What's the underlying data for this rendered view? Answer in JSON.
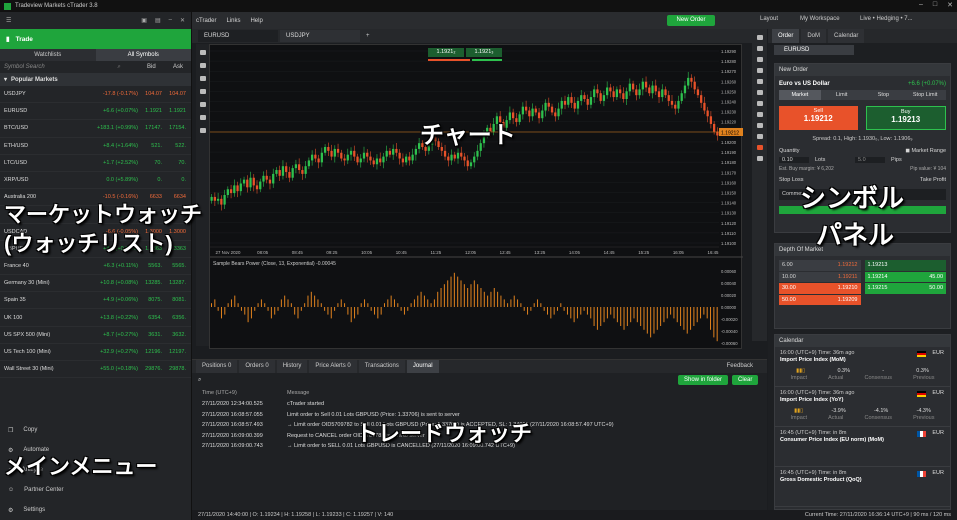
{
  "window": {
    "title": "Tradeview Markets cTrader 3.8"
  },
  "left": {
    "trade_label": "Trade",
    "tabs": [
      "Watchlists",
      "All Symbols"
    ],
    "search_placeholder": "Symbol Search",
    "col_bid": "Bid",
    "col_ask": "Ask",
    "section": "Popular Markets",
    "symbols": [
      {
        "name": "USDJPY",
        "chg": "-17.8 (-0.17%)",
        "bid": "104.07",
        "ask": "104.07",
        "dir": "neg"
      },
      {
        "name": "EURUSD",
        "chg": "+6.6 (+0.07%)",
        "bid": "1.1921",
        "ask": "1.1921",
        "dir": "pos"
      },
      {
        "name": "BTC/USD",
        "chg": "+183.1 (+0.99%)",
        "bid": "17147.",
        "ask": "17154.",
        "dir": "pos"
      },
      {
        "name": "ETH/USD",
        "chg": "+8.4 (+1.64%)",
        "bid": "521.",
        "ask": "522.",
        "dir": "pos"
      },
      {
        "name": "LTC/USD",
        "chg": "+1.7 (+2.52%)",
        "bid": "70.",
        "ask": "70.",
        "dir": "pos"
      },
      {
        "name": "XRP/USD",
        "chg": "0.0 (+5.89%)",
        "bid": "0.",
        "ask": "0.",
        "dir": "pos"
      },
      {
        "name": "Australia 200",
        "chg": "-10.5 (-0.16%)",
        "bid": "6633",
        "ask": "6634",
        "dir": "neg"
      },
      {
        "name": "",
        "chg": "",
        "bid": "",
        "ask": "",
        "dir": "pos"
      },
      {
        "name": "USDCAD",
        "chg": "-6.6 (-0.05%)",
        "bid": "1.3000",
        "ask": "1.3000",
        "dir": "neg"
      },
      {
        "name": "GBPUSD",
        "chg": "+8.3 (+0.06%)",
        "bid": "1.3363",
        "ask": "1.3363",
        "dir": "pos"
      },
      {
        "name": "France 40",
        "chg": "+6.3 (+0.11%)",
        "bid": "5563.",
        "ask": "5565.",
        "dir": "pos"
      },
      {
        "name": "Germany 30 (Mini)",
        "chg": "+10.8 (+0.08%)",
        "bid": "13285.",
        "ask": "13287.",
        "dir": "pos"
      },
      {
        "name": "Spain 35",
        "chg": "+4.9 (+0.06%)",
        "bid": "8075.",
        "ask": "8081.",
        "dir": "pos"
      },
      {
        "name": "UK 100",
        "chg": "+13.8 (+0.22%)",
        "bid": "6354.",
        "ask": "6356.",
        "dir": "pos"
      },
      {
        "name": "US SPX 500 (Mini)",
        "chg": "+8.7 (+0.27%)",
        "bid": "3631.",
        "ask": "3632.",
        "dir": "pos"
      },
      {
        "name": "US Tech 100 (Mini)",
        "chg": "+32.9 (+0.27%)",
        "bid": "12196.",
        "ask": "12197.",
        "dir": "pos"
      },
      {
        "name": "Wall Street 30 (Mini)",
        "chg": "+55.0 (+0.18%)",
        "bid": "29876.",
        "ask": "29878.",
        "dir": "pos"
      }
    ],
    "menu": [
      "Copy",
      "Automate",
      "Analyze",
      "Partner Center",
      "Settings"
    ]
  },
  "overlays": {
    "market_watch": "マーケットウォッチ",
    "watchlist": "(ウォッチリスト)",
    "main_menu": "メインメニュー",
    "chart": "チャート",
    "symbol": "シンボル",
    "panel": "パネル",
    "trade_watch": "トレードウォッチ"
  },
  "topbar": {
    "menus": [
      "cTrader",
      "Links",
      "Help"
    ],
    "new_order": "New Order",
    "layout": "Layout",
    "workspace": "My Workspace",
    "account": "Live • Hedging • 7..."
  },
  "chart_tabs": [
    "EURUSD",
    "USDJPY"
  ],
  "chart": {
    "sell_price": "1.1921₂",
    "buy_price": "1.1921₃",
    "price_ticks": [
      "1.19290",
      "1.19280",
      "1.19270",
      "1.19260",
      "1.19250",
      "1.19240",
      "1.19230",
      "1.19220",
      "1.19210",
      "1.19200",
      "1.19190",
      "1.19180",
      "1.19170",
      "1.19160",
      "1.19150",
      "1.19140",
      "1.19130",
      "1.19120",
      "1.19110",
      "1.19100"
    ],
    "current_price": "1.19212",
    "time_ticks": [
      "27 Nov 2020",
      "08:05",
      "08:45",
      "09:25",
      "10:05",
      "10:45",
      "11:25",
      "12:05",
      "12:45",
      "13:25",
      "14:05",
      "14:45",
      "15:25",
      "16:05",
      "16:45"
    ],
    "indicator_label": "Sample Bears Power (Close, 13, Exponential) -0.00045",
    "indicator_ticks": [
      "0.00060",
      "0.00040",
      "0.00020",
      "0.00000",
      "-0.00020",
      "-0.00040",
      "-0.00060"
    ],
    "closes": [
      0.24,
      0.22,
      0.23,
      0.2,
      0.25,
      0.28,
      0.26,
      0.3,
      0.27,
      0.31,
      0.33,
      0.29,
      0.34,
      0.3,
      0.28,
      0.32,
      0.35,
      0.33,
      0.31,
      0.36,
      0.38,
      0.35,
      0.4,
      0.37,
      0.34,
      0.39,
      0.41,
      0.38,
      0.36,
      0.4,
      0.43,
      0.46,
      0.44,
      0.42,
      0.47,
      0.5,
      0.48,
      0.45,
      0.49,
      0.47,
      0.44,
      0.43,
      0.46,
      0.48,
      0.45,
      0.42,
      0.44,
      0.47,
      0.45,
      0.43,
      0.41,
      0.44,
      0.42,
      0.45,
      0.48,
      0.46,
      0.49,
      0.47,
      0.44,
      0.42,
      0.45,
      0.43,
      0.46,
      0.49,
      0.52,
      0.5,
      0.48,
      0.51,
      0.55,
      0.53,
      0.5,
      0.48,
      0.45,
      0.43,
      0.46,
      0.44,
      0.47,
      0.45,
      0.43,
      0.4,
      0.42,
      0.45,
      0.48,
      0.52,
      0.56,
      0.6,
      0.58,
      0.62,
      0.66,
      0.63,
      0.6,
      0.64,
      0.68,
      0.65,
      0.63,
      0.67,
      0.71,
      0.69,
      0.66,
      0.7,
      0.68,
      0.65,
      0.69,
      0.73,
      0.71,
      0.68,
      0.66,
      0.7,
      0.74,
      0.72,
      0.76,
      0.73,
      0.7,
      0.74,
      0.77,
      0.75,
      0.72,
      0.76,
      0.8,
      0.78,
      0.74,
      0.77,
      0.81,
      0.79,
      0.76,
      0.8,
      0.78,
      0.75,
      0.79,
      0.83,
      0.8,
      0.77,
      0.8,
      0.84,
      0.81,
      0.78,
      0.82,
      0.79,
      0.76,
      0.8,
      0.77,
      0.74,
      0.72,
      0.7,
      0.74,
      0.78,
      0.82,
      0.86,
      0.84,
      0.8,
      0.77,
      0.73,
      0.69,
      0.66,
      0.62,
      0.58,
      0.56
    ],
    "bears": [
      0.1,
      0.2,
      -0.1,
      -0.3,
      -0.2,
      0.1,
      0.2,
      0.3,
      0.1,
      -0.1,
      -0.2,
      -0.4,
      -0.3,
      -0.1,
      0.1,
      0.2,
      0.1,
      -0.1,
      -0.3,
      -0.2,
      -0.1,
      0.2,
      0.3,
      0.2,
      0.1,
      -0.2,
      -0.3,
      -0.1,
      0.1,
      0.3,
      0.4,
      0.3,
      0.2,
      0.1,
      -0.1,
      -0.2,
      -0.3,
      -0.1,
      0.1,
      0.2,
      0.1,
      -0.2,
      -0.4,
      -0.3,
      -0.2,
      0.1,
      0.2,
      0.1,
      -0.1,
      -0.2,
      -0.3,
      -0.2,
      0.1,
      0.2,
      0.3,
      0.2,
      0.1,
      -0.1,
      -0.2,
      -0.1,
      0.1,
      0.2,
      0.3,
      0.4,
      0.3,
      0.2,
      0.1,
      0.2,
      0.4,
      0.5,
      0.6,
      0.7,
      0.8,
      0.9,
      0.8,
      0.7,
      0.6,
      0.5,
      0.6,
      0.7,
      0.6,
      0.5,
      0.4,
      0.3,
      0.4,
      0.5,
      0.4,
      0.3,
      0.2,
      0.1,
      0.2,
      0.3,
      0.2,
      0.1,
      -0.1,
      -0.2,
      -0.1,
      0.1,
      0.2,
      0.1,
      -0.1,
      -0.2,
      -0.3,
      -0.2,
      -0.1,
      0.1,
      -0.1,
      -0.2,
      -0.3,
      -0.4,
      -0.3,
      -0.2,
      -0.1,
      -0.2,
      -0.3,
      -0.5,
      -0.6,
      -0.5,
      -0.4,
      -0.3,
      -0.2,
      -0.3,
      -0.4,
      -0.5,
      -0.6,
      -0.5,
      -0.4,
      -0.3,
      -0.4,
      -0.5,
      -0.6,
      -0.7,
      -0.8,
      -0.7,
      -0.6,
      -0.5,
      -0.4,
      -0.3,
      -0.2,
      -0.3,
      -0.4,
      -0.5,
      -0.6,
      -0.7,
      -0.6,
      -0.5,
      -0.4,
      -0.3,
      -0.2,
      -0.3,
      -0.6,
      -0.8,
      -0.9
    ]
  },
  "trade_watch": {
    "tabs": [
      "Positions 0",
      "Orders 0",
      "History",
      "Price Alerts 0",
      "Transactions",
      "Journal"
    ],
    "feedback": "Feedback",
    "show_in_folder": "Show in folder",
    "clear": "Clear",
    "col_time": "Time (UTC+9)",
    "col_msg": "Message",
    "log": [
      {
        "t": "27/11/2020 12:34:00.525",
        "m": "cTrader started"
      },
      {
        "t": "27/11/2020 16:08:57.055",
        "m": "Limit order to Sell 0.01 Lots GBPUSD (Price: 1.33706) is sent to server"
      },
      {
        "t": "27/11/2020 16:08:57.493",
        "m": "→ Limit order OID5709782 to Sell 0.01 Lots GBPUSD (Price: 1.33706) is ACCEPTED, SL: 1.34006 (27/11/2020 16:08:57.497 UTC+9)"
      },
      {
        "t": "27/11/2020 16:09:00.399",
        "m": "Request to CANCEL order OID5709782 is sent to server"
      },
      {
        "t": "27/11/2020 16:09:00.743",
        "m": "→ Limit order to SELL 0.01 Lots GBPUSD is CANCELLED (27/11/2020 16:09:00.742 UTC+9)"
      }
    ]
  },
  "status": {
    "left": "27/11/2020 14:40:00 | O: 1.19234 | H: 1.19258 | L: 1.19233 | C: 1.19257 | V: 140",
    "right": "Current Time: 27/11/2020 16:36:14   UTC+9   |   90 ms / 120 ms"
  },
  "right": {
    "tabs": [
      "Order",
      "DoM",
      "Calendar"
    ],
    "symbol": "EURUSD",
    "new_order_title": "New Order",
    "pair_name": "Euro vs US Dollar",
    "pair_change": "+6.6 (+0.07%)",
    "order_types": [
      "Market",
      "Limit",
      "Stop",
      "Stop Limit"
    ],
    "sell_label": "Sell",
    "sell_price": "1.19212",
    "buy_label": "Buy",
    "buy_price": "1.19213",
    "spread": "Spread: 0.1, High: 1.1930₀, Low: 1.1906₉",
    "quantity_label": "Quantity",
    "market_range_label": "Market Range",
    "quantity_value": "0.10",
    "lots_label": "Lots",
    "range_value": "5.0",
    "pips_label": "Pips",
    "margin": "Est. Buy margin: ¥ 6,202",
    "pip_value": "Pip value: ¥ 104",
    "stop_loss": "Stop Loss",
    "take_profit": "Take Profit",
    "comment": "Comment",
    "dom_title": "Depth Of Market",
    "dom_sell": [
      {
        "vol": "6.00",
        "price": "1.19212"
      },
      {
        "vol": "10.00",
        "price": "1.19211"
      },
      {
        "vol": "30.00",
        "price": "1.19210"
      },
      {
        "vol": "50.00",
        "price": "1.19209"
      }
    ],
    "dom_buy": [
      {
        "vol": "",
        "price": "1.19213"
      },
      {
        "vol": "45.00",
        "price": "1.19214"
      },
      {
        "vol": "50.00",
        "price": "1.19215"
      }
    ],
    "cal_title": "Calendar",
    "calendar": [
      {
        "time": "16:00 (UTC+9) Time: 36m ago",
        "ccy": "EUR",
        "name": "Import Price Index (MoM)",
        "actual": "0.3%",
        "consensus": "-",
        "previous": "0.3%",
        "flag": "de"
      },
      {
        "time": "16:00 (UTC+9) Time: 36m ago",
        "ccy": "EUR",
        "name": "Import Price Index (YoY)",
        "actual": "-3.9%",
        "consensus": "-4.1%",
        "previous": "-4.3%",
        "flag": "de"
      },
      {
        "time": "16:45 (UTC+9) Time: in 8m",
        "ccy": "EUR",
        "name": "Consumer Price Index (EU norm) (MoM)",
        "actual": "",
        "consensus": "",
        "previous": "",
        "flag": "fr"
      },
      {
        "time": "16:45 (UTC+9) Time: in 8m",
        "ccy": "EUR",
        "name": "Gross Domestic Product (QoQ)",
        "actual": "",
        "consensus": "",
        "previous": "",
        "flag": "fr"
      }
    ],
    "cal_labels": [
      "Impact",
      "Actual",
      "Consensus",
      "Previous"
    ]
  },
  "colors": {
    "accent": "#1fa53c",
    "sell": "#e8522a",
    "bull": "#2ec14e",
    "bear": "#e8522a",
    "indicator": "#e0821e",
    "overlay_text": "#ffffff"
  }
}
